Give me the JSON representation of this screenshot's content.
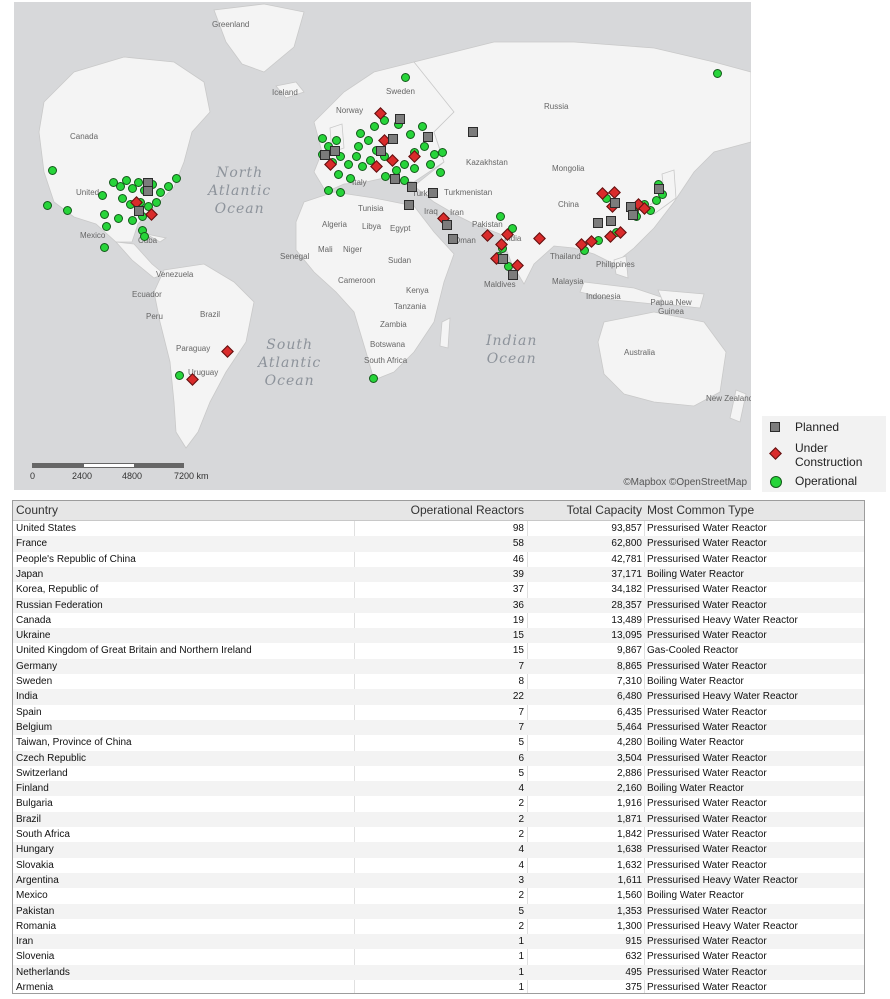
{
  "map": {
    "country_labels": [
      "Greenland",
      "Iceland",
      "Sweden",
      "Norway",
      "Russia",
      "Canada",
      "United",
      "Mexico",
      "Cuba",
      "Venezuela",
      "Ecuador",
      "Peru",
      "Brazil",
      "Paraguay",
      "Uruguay",
      "Kazakhstan",
      "Mongolia",
      "China",
      "Turkmenistan",
      "Turkey",
      "Italy",
      "Tunisia",
      "Iraq",
      "Iran",
      "Pakistan",
      "India",
      "Algeria",
      "Libya",
      "Egypt",
      "Mali",
      "Niger",
      "Senegal",
      "Sudan",
      "Cameroon",
      "Oman",
      "Kenya",
      "Tanzania",
      "Zambia",
      "Botswana",
      "South Africa",
      "Thailand",
      "Philippines",
      "Malaysia",
      "Indonesia",
      "Papua New Guinea",
      "Maldives",
      "Australia",
      "New Zealand"
    ],
    "ocean_labels": [
      "North\nAtlantic\nOcean",
      "South\nAtlantic\nOcean",
      "Indian\nOcean"
    ],
    "attribution": "©Mapbox ©OpenStreetMap",
    "scale": {
      "ticks": [
        "0",
        "2400",
        "4800",
        "7200 km"
      ]
    },
    "marker_categories": [
      "Planned",
      "Under Construction",
      "Operational"
    ],
    "colors": {
      "planned": "#7c7c7c",
      "under_construction": "#d92b2b",
      "operational": "#27d43a",
      "water": "#d7d8da",
      "land": "#f4f4f4"
    }
  },
  "legend": {
    "items": [
      {
        "label": "Planned",
        "symbol": "gray-square-icon"
      },
      {
        "label": "Under\nConstruction",
        "symbol": "red-diamond-icon"
      },
      {
        "label": "Operational",
        "symbol": "green-circle-icon"
      }
    ]
  },
  "table": {
    "headers": [
      "Country",
      "Operational Reactors",
      "Total Capacity",
      "Most Common Type"
    ],
    "rows": [
      [
        "United States",
        "98",
        "93,857",
        "Pressurised Water Reactor"
      ],
      [
        "France",
        "58",
        "62,800",
        "Pressurised Water Reactor"
      ],
      [
        "People's Republic of China",
        "46",
        "42,781",
        "Pressurised Water Reactor"
      ],
      [
        "Japan",
        "39",
        "37,171",
        "Boiling Water Reactor"
      ],
      [
        "Korea, Republic of",
        "37",
        "34,182",
        "Pressurised Water Reactor"
      ],
      [
        "Russian Federation",
        "36",
        "28,357",
        "Pressurised Water Reactor"
      ],
      [
        "Canada",
        "19",
        "13,489",
        "Pressurised Heavy Water Reactor"
      ],
      [
        "Ukraine",
        "15",
        "13,095",
        "Pressurised Water Reactor"
      ],
      [
        "United Kingdom of Great Britain and Northern Ireland",
        "15",
        "9,867",
        "Gas-Cooled Reactor"
      ],
      [
        "Germany",
        "7",
        "8,865",
        "Pressurised Water Reactor"
      ],
      [
        "Sweden",
        "8",
        "7,310",
        "Boiling Water Reactor"
      ],
      [
        "India",
        "22",
        "6,480",
        "Pressurised Heavy Water Reactor"
      ],
      [
        "Spain",
        "7",
        "6,435",
        "Pressurised Water Reactor"
      ],
      [
        "Belgium",
        "7",
        "5,464",
        "Pressurised Water Reactor"
      ],
      [
        "Taiwan, Province of China",
        "5",
        "4,280",
        "Boiling Water Reactor"
      ],
      [
        "Czech Republic",
        "6",
        "3,504",
        "Pressurised Water Reactor"
      ],
      [
        "Switzerland",
        "5",
        "2,886",
        "Pressurised Water Reactor"
      ],
      [
        "Finland",
        "4",
        "2,160",
        "Boiling Water Reactor"
      ],
      [
        "Bulgaria",
        "2",
        "1,916",
        "Pressurised Water Reactor"
      ],
      [
        "Brazil",
        "2",
        "1,871",
        "Pressurised Water Reactor"
      ],
      [
        "South Africa",
        "2",
        "1,842",
        "Pressurised Water Reactor"
      ],
      [
        "Hungary",
        "4",
        "1,638",
        "Pressurised Water Reactor"
      ],
      [
        "Slovakia",
        "4",
        "1,632",
        "Pressurised Water Reactor"
      ],
      [
        "Argentina",
        "3",
        "1,611",
        "Pressurised Heavy Water Reactor"
      ],
      [
        "Mexico",
        "2",
        "1,560",
        "Boiling Water Reactor"
      ],
      [
        "Pakistan",
        "5",
        "1,353",
        "Pressurised Water Reactor"
      ],
      [
        "Romania",
        "2",
        "1,300",
        "Pressurised Heavy Water Reactor"
      ],
      [
        "Iran",
        "1",
        "915",
        "Pressurised Water Reactor"
      ],
      [
        "Slovenia",
        "1",
        "632",
        "Pressurised Water Reactor"
      ],
      [
        "Netherlands",
        "1",
        "495",
        "Pressurised Water Reactor"
      ],
      [
        "Armenia",
        "1",
        "375",
        "Pressurised Water Reactor"
      ]
    ]
  }
}
